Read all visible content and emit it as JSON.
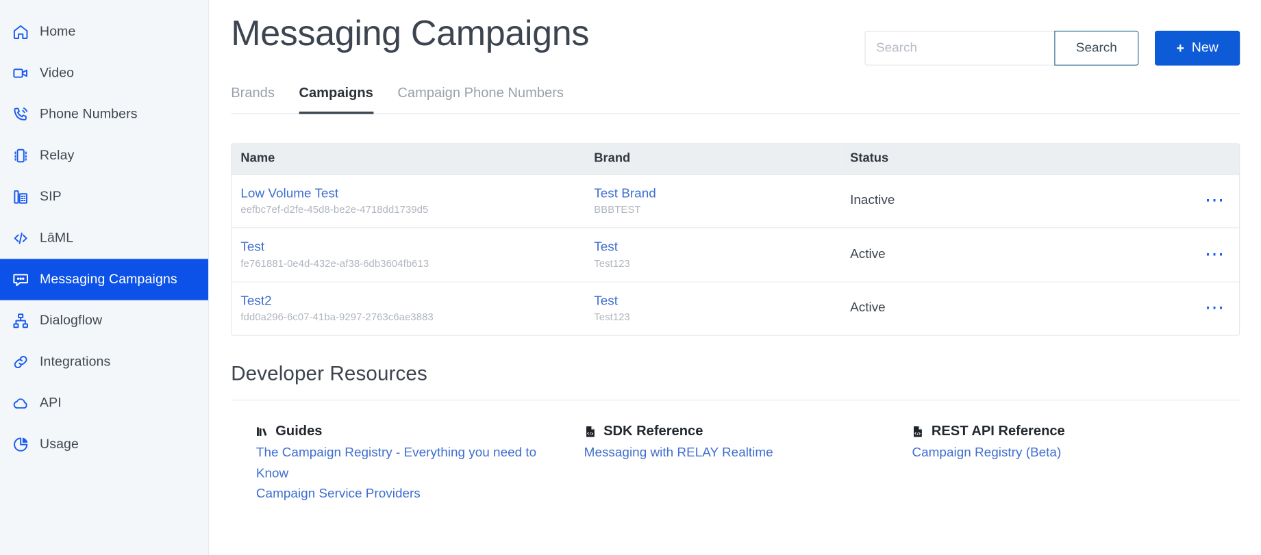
{
  "sidebar": {
    "items": [
      {
        "label": "Home",
        "icon": "home-icon",
        "active": false
      },
      {
        "label": "Video",
        "icon": "video-icon",
        "active": false
      },
      {
        "label": "Phone Numbers",
        "icon": "phone-icon",
        "active": false
      },
      {
        "label": "Relay",
        "icon": "relay-icon",
        "active": false
      },
      {
        "label": "SIP",
        "icon": "sip-icon",
        "active": false
      },
      {
        "label": "LāML",
        "icon": "code-icon",
        "active": false
      },
      {
        "label": "Messaging Campaigns",
        "icon": "chat-icon",
        "active": true
      },
      {
        "label": "Dialogflow",
        "icon": "sitemap-icon",
        "active": false
      },
      {
        "label": "Integrations",
        "icon": "link-icon",
        "active": false
      },
      {
        "label": "API",
        "icon": "cloud-icon",
        "active": false
      },
      {
        "label": "Usage",
        "icon": "pie-chart-icon",
        "active": false
      }
    ],
    "active_bg": "#0d52e8"
  },
  "header": {
    "title": "Messaging Campaigns",
    "search_placeholder": "Search",
    "search_value": "",
    "search_button": "Search",
    "new_button": "New",
    "new_button_icon": "plus-icon",
    "new_button_color": "#0d5bd6"
  },
  "tabs": [
    {
      "label": "Brands",
      "active": false
    },
    {
      "label": "Campaigns",
      "active": true
    },
    {
      "label": "Campaign Phone Numbers",
      "active": false
    }
  ],
  "table": {
    "columns": [
      "Name",
      "Brand",
      "Status"
    ],
    "rows": [
      {
        "name": "Low Volume Test",
        "name_id": "eefbc7ef-d2fe-45d8-be2e-4718dd1739d5",
        "brand": "Test Brand",
        "brand_id": "BBBTEST",
        "status": "Inactive",
        "actions_icon": "ellipsis-icon"
      },
      {
        "name": "Test",
        "name_id": "fe761881-0e4d-432e-af38-6db3604fb613",
        "brand": "Test",
        "brand_id": "Test123",
        "status": "Active",
        "actions_icon": "ellipsis-icon"
      },
      {
        "name": "Test2",
        "name_id": "fdd0a296-6c07-41ba-9297-2763c6ae3883",
        "brand": "Test",
        "brand_id": "Test123",
        "status": "Active",
        "actions_icon": "ellipsis-icon"
      }
    ]
  },
  "developer_resources": {
    "heading": "Developer Resources",
    "columns": [
      {
        "title": "Guides",
        "icon": "books-icon",
        "links": [
          "The Campaign Registry - Everything you need to Know",
          "Campaign Service Providers"
        ]
      },
      {
        "title": "SDK Reference",
        "icon": "file-code-icon",
        "links": [
          "Messaging with RELAY Realtime"
        ]
      },
      {
        "title": "REST API Reference",
        "icon": "file-code-icon",
        "links": [
          "Campaign Registry (Beta)"
        ]
      }
    ]
  }
}
